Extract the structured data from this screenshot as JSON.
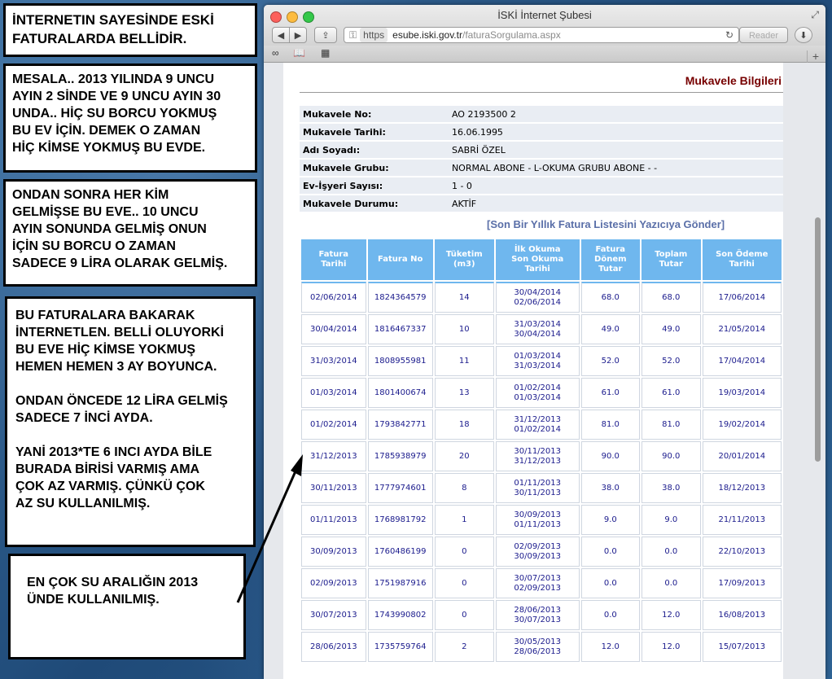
{
  "notes": {
    "n1": "İNTERNETIN SAYESİNDE ESKİ\nFATURALARDA BELLİDİR.",
    "n2": "MESALA.. 2013 YILINDA 9 UNCU\nAYIN 2 SİNDE VE 9 UNCU AYIN 30\nUNDA.. HİÇ SU BORCU YOKMUŞ\nBU EV İÇİN. DEMEK O ZAMAN\nHİÇ KİMSE YOKMUŞ BU EVDE.",
    "n3": "ONDAN SONRA HER KİM\nGELMİŞSE BU EVE.. 10 UNCU\nAYIN SONUNDA GELMİŞ ONUN\nİÇİN SU BORCU O ZAMAN\nSADECE 9 LİRA OLARAK GELMİŞ.",
    "n4a": "BU FATURALARA BAKARAK\nİNTERNETLEN. BELLİ OLUYORKİ\nBU EVE HİÇ KİMSE YOKMUŞ\nHEMEN HEMEN 3 AY BOYUNCA.",
    "n4b": "ONDAN ÖNCEDE 12 LİRA GELMİŞ\nSADECE 7 İNCİ AYDA.",
    "n4c": "YANİ 2013*TE 6 INCI AYDA BİLE\nBURADA BİRİSİ VARMIŞ AMA\nÇOK AZ VARMIŞ.  ÇÜNKÜ ÇOK\nAZ SU KULLANILMIŞ.",
    "n5": "EN ÇOK SU ARALIĞIN 2013\nÜNDE KULLANILMIŞ."
  },
  "browser": {
    "window_title": "İSKİ İnternet Şubesi",
    "url_scheme": "https",
    "url_host": "esube.iski.gov.tr",
    "url_path": "/faturaSorgulama.aspx",
    "reader_label": "Reader",
    "new_tab": "+"
  },
  "page": {
    "section_title": "Mukavele Bilgileri",
    "info": [
      {
        "label": "Mukavele No:",
        "value": "AO 2193500 2"
      },
      {
        "label": "Mukavele Tarihi:",
        "value": "16.06.1995"
      },
      {
        "label": "Adı Soyadı:",
        "value": "SABRİ ÖZEL"
      },
      {
        "label": "Mukavele Grubu:",
        "value": "NORMAL ABONE - L-OKUMA GRUBU ABONE - -"
      },
      {
        "label": "Ev-İşyeri Sayısı:",
        "value": "1 - 0"
      },
      {
        "label": "Mukavele Durumu:",
        "value": "AKTİF"
      }
    ],
    "print_link": "[Son Bir Yıllık Fatura Listesini Yazıcıya Gönder]",
    "columns": [
      "Fatura\nTarihi",
      "Fatura No",
      "Tüketim\n(m3)",
      "İlk Okuma\nSon Okuma\nTarihi",
      "Fatura\nDönem\nTutar",
      "Toplam\nTutar",
      "Son Ödeme\nTarihi"
    ],
    "rows": [
      [
        "02/06/2014",
        "1824364579",
        "14",
        "30/04/2014\n02/06/2014",
        "68.0",
        "68.0",
        "17/06/2014"
      ],
      [
        "30/04/2014",
        "1816467337",
        "10",
        "31/03/2014\n30/04/2014",
        "49.0",
        "49.0",
        "21/05/2014"
      ],
      [
        "31/03/2014",
        "1808955981",
        "11",
        "01/03/2014\n31/03/2014",
        "52.0",
        "52.0",
        "17/04/2014"
      ],
      [
        "01/03/2014",
        "1801400674",
        "13",
        "01/02/2014\n01/03/2014",
        "61.0",
        "61.0",
        "19/03/2014"
      ],
      [
        "01/02/2014",
        "1793842771",
        "18",
        "31/12/2013\n01/02/2014",
        "81.0",
        "81.0",
        "19/02/2014"
      ],
      [
        "31/12/2013",
        "1785938979",
        "20",
        "30/11/2013\n31/12/2013",
        "90.0",
        "90.0",
        "20/01/2014"
      ],
      [
        "30/11/2013",
        "1777974601",
        "8",
        "01/11/2013\n30/11/2013",
        "38.0",
        "38.0",
        "18/12/2013"
      ],
      [
        "01/11/2013",
        "1768981792",
        "1",
        "30/09/2013\n01/11/2013",
        "9.0",
        "9.0",
        "21/11/2013"
      ],
      [
        "30/09/2013",
        "1760486199",
        "0",
        "02/09/2013\n30/09/2013",
        "0.0",
        "0.0",
        "22/10/2013"
      ],
      [
        "02/09/2013",
        "1751987916",
        "0",
        "30/07/2013\n02/09/2013",
        "0.0",
        "0.0",
        "17/09/2013"
      ],
      [
        "30/07/2013",
        "1743990802",
        "0",
        "28/06/2013\n30/07/2013",
        "0.0",
        "12.0",
        "16/08/2013"
      ],
      [
        "28/06/2013",
        "1735759764",
        "2",
        "30/05/2013\n28/06/2013",
        "12.0",
        "12.0",
        "15/07/2013"
      ]
    ]
  }
}
